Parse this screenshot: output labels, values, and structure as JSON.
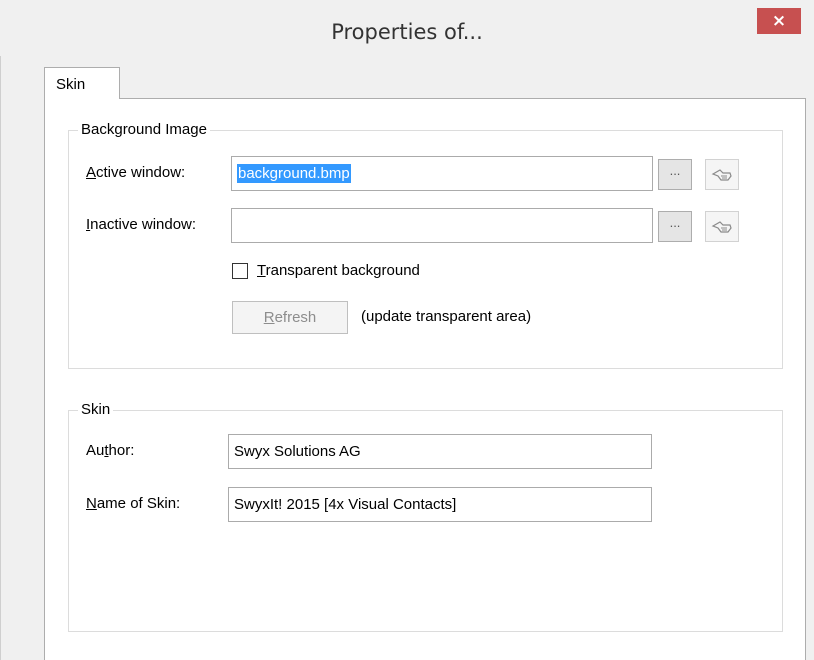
{
  "window": {
    "title": "Properties of...",
    "close_glyph": "×"
  },
  "tabs": [
    {
      "label": "Skin",
      "active": true
    }
  ],
  "background_group": {
    "label": "Background Image",
    "active_window": {
      "label_first": "A",
      "label_rest": "ctive window:",
      "value": "background.bmp",
      "browse_label": "..."
    },
    "inactive_window": {
      "label_first": "I",
      "label_rest": "nactive window:",
      "value": "",
      "browse_label": "..."
    },
    "transparent": {
      "label_first": "T",
      "label_rest": "ransparent background",
      "checked": false
    },
    "refresh": {
      "label_first": "R",
      "label_rest": "efresh",
      "enabled": false,
      "hint": "(update transparent area)"
    }
  },
  "skin_group": {
    "label": "Skin",
    "author": {
      "label_pre": "Au",
      "label_ul": "t",
      "label_post": "hor:",
      "value": "Swyx Solutions AG"
    },
    "name": {
      "label_first": "N",
      "label_rest": "ame of Skin:",
      "value": "SwyxIt! 2015 [4x Visual Contacts]"
    }
  },
  "icons": {
    "close": "close-icon",
    "browse": "ellipsis-icon",
    "preview": "hand-pointer-icon"
  },
  "colors": {
    "close_button": "#c75050",
    "selection": "#3399ff"
  }
}
